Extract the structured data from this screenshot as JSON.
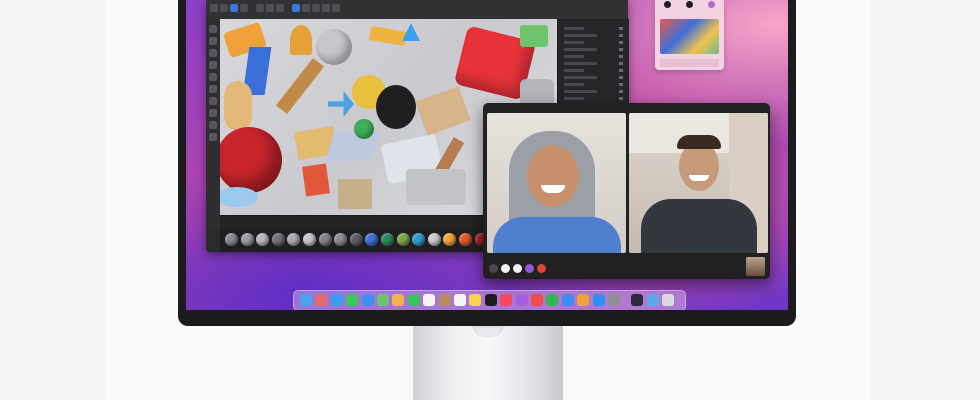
{
  "device": {
    "accent_bezel": "#1b1b1d",
    "wallpaper_colors": [
      "#8b3fc7",
      "#d55aa7",
      "#5d2ec6",
      "#f6a6c9"
    ]
  },
  "app_window": {
    "icon_names": [
      "move-tool-icon",
      "rotate-tool-icon",
      "scale-tool-icon",
      "select-tool-icon",
      "render-icon",
      "camera-icon",
      "light-icon",
      "cube-icon",
      "sphere-icon",
      "spline-icon",
      "deformer-icon",
      "material-icon"
    ],
    "material_colors": [
      "#8a8a90",
      "#9b9ba3",
      "#b7b7bc",
      "#6f6f75",
      "#a9a9ae",
      "#c7c7cb",
      "#7f7f85",
      "#8c8c92",
      "#5c5c62",
      "#3e6fd8",
      "#2b8a5a",
      "#7da34a",
      "#2e9bd0",
      "#c9c9cc",
      "#f2a23a",
      "#e0582f",
      "#b01d1d",
      "#d8d8db",
      "#a1a1a6",
      "#9a9aa0",
      "#b4b4b9"
    ]
  },
  "widget": {
    "icon_colors": [
      "#1e1e20",
      "#1e1e20",
      "#b16acd"
    ]
  },
  "facetime": {
    "control_colors": [
      "#4a4a4e",
      "#f2f2f3",
      "#f2f2f3",
      "#8e5bd6",
      "#e0433a"
    ],
    "participants": [
      "participant-left",
      "participant-right"
    ]
  },
  "dock": {
    "apps": [
      {
        "name": "finder-icon",
        "color": "#4aa3f0"
      },
      {
        "name": "launchpad-icon",
        "color": "#e46b6b"
      },
      {
        "name": "safari-icon",
        "color": "#3a9bf2"
      },
      {
        "name": "messages-icon",
        "color": "#3cc55a"
      },
      {
        "name": "mail-icon",
        "color": "#3f8ff0"
      },
      {
        "name": "maps-icon",
        "color": "#6ec46d"
      },
      {
        "name": "photos-icon",
        "color": "#f2b347"
      },
      {
        "name": "facetime-icon",
        "color": "#39c25b"
      },
      {
        "name": "calendar-icon",
        "color": "#f6f6f6"
      },
      {
        "name": "contacts-icon",
        "color": "#b88c5e"
      },
      {
        "name": "reminders-icon",
        "color": "#f5f5f5"
      },
      {
        "name": "notes-icon",
        "color": "#f7d24a"
      },
      {
        "name": "apple-tv-icon",
        "color": "#1d1d1f"
      },
      {
        "name": "music-icon",
        "color": "#f2495c"
      },
      {
        "name": "podcasts-icon",
        "color": "#a65ee0"
      },
      {
        "name": "news-icon",
        "color": "#f14b4b"
      },
      {
        "name": "numbers-icon",
        "color": "#33b554"
      },
      {
        "name": "keynote-icon",
        "color": "#3b8cf2"
      },
      {
        "name": "pages-icon",
        "color": "#f2a13a"
      },
      {
        "name": "app-store-icon",
        "color": "#2f8ef2"
      },
      {
        "name": "system-preferences-icon",
        "color": "#8e8e93"
      },
      {
        "name": "cinema4d-icon",
        "color": "#2a2a3a"
      },
      {
        "name": "downloads-icon",
        "color": "#5ba9e8"
      },
      {
        "name": "trash-icon",
        "color": "#d9d9de"
      }
    ]
  }
}
